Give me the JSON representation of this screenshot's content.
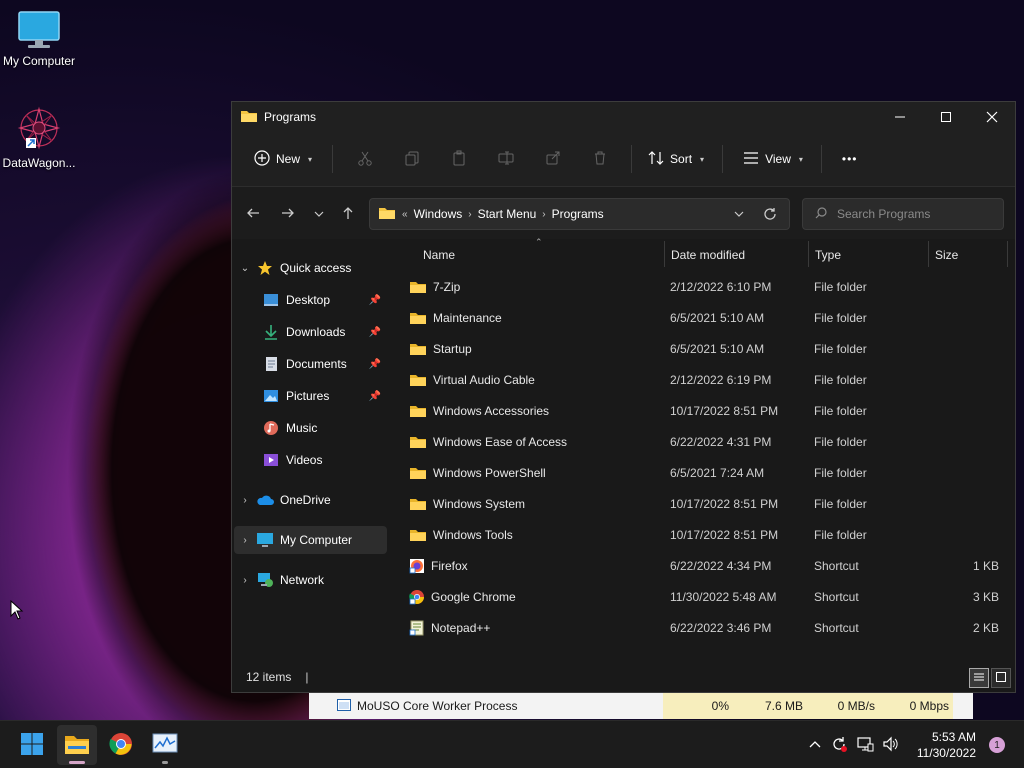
{
  "desktop": {
    "icons": [
      {
        "label": "My Computer",
        "icon": "monitor-icon"
      },
      {
        "label": "DataWagon...",
        "icon": "datawagon-logo-icon"
      }
    ]
  },
  "window": {
    "title": "Programs",
    "toolbar": {
      "new_label": "New",
      "sort_label": "Sort",
      "view_label": "View",
      "more_label": "•••"
    },
    "address": {
      "prefix": "«",
      "crumbs": [
        "Windows",
        "Start Menu",
        "Programs"
      ],
      "separator": "›"
    },
    "search": {
      "placeholder": "Search Programs"
    },
    "sidebar": {
      "quick_access": "Quick access",
      "items": [
        {
          "label": "Desktop",
          "icon": "desktop-icon",
          "pinned": true
        },
        {
          "label": "Downloads",
          "icon": "download-icon",
          "pinned": true
        },
        {
          "label": "Documents",
          "icon": "document-icon",
          "pinned": true
        },
        {
          "label": "Pictures",
          "icon": "pictures-icon",
          "pinned": true
        },
        {
          "label": "Music",
          "icon": "music-icon",
          "pinned": false
        },
        {
          "label": "Videos",
          "icon": "videos-icon",
          "pinned": false
        }
      ],
      "onedrive": "OneDrive",
      "my_computer": "My Computer",
      "network": "Network"
    },
    "columns": {
      "name": "Name",
      "date": "Date modified",
      "type": "Type",
      "size": "Size"
    },
    "files": [
      {
        "name": "7-Zip",
        "date": "2/12/2022 6:10 PM",
        "type": "File folder",
        "size": "",
        "icon": "folder-icon"
      },
      {
        "name": "Maintenance",
        "date": "6/5/2021 5:10 AM",
        "type": "File folder",
        "size": "",
        "icon": "folder-icon"
      },
      {
        "name": "Startup",
        "date": "6/5/2021 5:10 AM",
        "type": "File folder",
        "size": "",
        "icon": "folder-icon"
      },
      {
        "name": "Virtual Audio Cable",
        "date": "2/12/2022 6:19 PM",
        "type": "File folder",
        "size": "",
        "icon": "folder-icon"
      },
      {
        "name": "Windows Accessories",
        "date": "10/17/2022 8:51 PM",
        "type": "File folder",
        "size": "",
        "icon": "folder-icon"
      },
      {
        "name": "Windows Ease of Access",
        "date": "6/22/2022 4:31 PM",
        "type": "File folder",
        "size": "",
        "icon": "folder-icon"
      },
      {
        "name": "Windows PowerShell",
        "date": "6/5/2021 7:24 AM",
        "type": "File folder",
        "size": "",
        "icon": "folder-icon"
      },
      {
        "name": "Windows System",
        "date": "10/17/2022 8:51 PM",
        "type": "File folder",
        "size": "",
        "icon": "folder-icon"
      },
      {
        "name": "Windows Tools",
        "date": "10/17/2022 8:51 PM",
        "type": "File folder",
        "size": "",
        "icon": "folder-icon"
      },
      {
        "name": "Firefox",
        "date": "6/22/2022 4:34 PM",
        "type": "Shortcut",
        "size": "1 KB",
        "icon": "firefox-icon"
      },
      {
        "name": "Google Chrome",
        "date": "11/30/2022 5:48 AM",
        "type": "Shortcut",
        "size": "3 KB",
        "icon": "chrome-icon"
      },
      {
        "name": "Notepad++",
        "date": "6/22/2022 3:46 PM",
        "type": "Shortcut",
        "size": "2 KB",
        "icon": "notepadpp-icon"
      }
    ],
    "status": {
      "items": "12 items",
      "bar": "|"
    }
  },
  "task_manager_row": {
    "name": "MoUSO Core Worker Process",
    "cpu": "0%",
    "memory": "7.6 MB",
    "disk": "0 MB/s",
    "network": "0 Mbps"
  },
  "taskbar": {
    "apps": [
      {
        "icon": "windows-start-icon"
      },
      {
        "icon": "file-explorer-icon"
      },
      {
        "icon": "chrome-icon"
      },
      {
        "icon": "task-manager-icon"
      }
    ],
    "time": "5:53 AM",
    "date": "11/30/2022",
    "notification_count": "1"
  },
  "colors": {
    "folder": "#f4c542",
    "accent": "#4cc2ff",
    "window_bg": "#191919"
  }
}
